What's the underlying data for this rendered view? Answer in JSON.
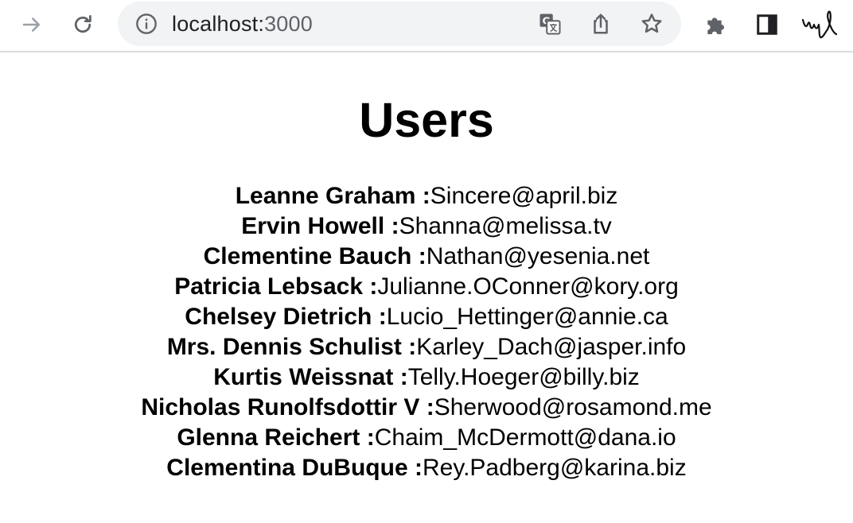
{
  "browser": {
    "url_host": "localhost:",
    "url_port": "3000",
    "icons": {
      "forward": "forward-arrow-icon",
      "reload": "reload-icon",
      "site_info": "info-icon",
      "translate": "translate-icon",
      "share": "share-icon",
      "bookmark": "star-icon",
      "extensions": "puzzle-icon",
      "side_panel": "side-panel-icon",
      "profile": "profile-avatar-icon"
    }
  },
  "page": {
    "title": "Users",
    "separator": " :",
    "users": [
      {
        "name": "Leanne Graham",
        "email": "Sincere@april.biz"
      },
      {
        "name": "Ervin Howell",
        "email": "Shanna@melissa.tv"
      },
      {
        "name": "Clementine Bauch",
        "email": "Nathan@yesenia.net"
      },
      {
        "name": "Patricia Lebsack",
        "email": "Julianne.OConner@kory.org"
      },
      {
        "name": "Chelsey Dietrich",
        "email": "Lucio_Hettinger@annie.ca"
      },
      {
        "name": "Mrs. Dennis Schulist",
        "email": "Karley_Dach@jasper.info"
      },
      {
        "name": "Kurtis Weissnat",
        "email": "Telly.Hoeger@billy.biz"
      },
      {
        "name": "Nicholas Runolfsdottir V",
        "email": "Sherwood@rosamond.me"
      },
      {
        "name": "Glenna Reichert",
        "email": "Chaim_McDermott@dana.io"
      },
      {
        "name": "Clementina DuBuque",
        "email": "Rey.Padberg@karina.biz"
      }
    ]
  }
}
